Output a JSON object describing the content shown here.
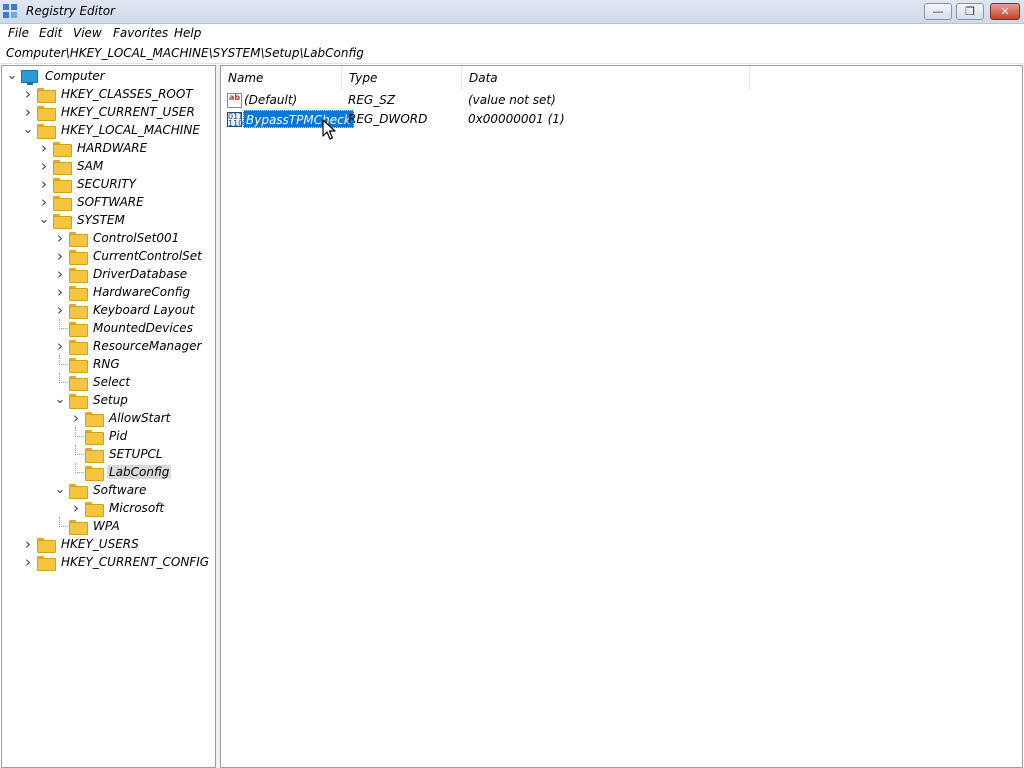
{
  "window": {
    "title": "Registry Editor",
    "min_glyph": "—",
    "restore_glyph": "❐",
    "close_glyph": "✕"
  },
  "menu": [
    "File",
    "Edit",
    "View",
    "Favorites",
    "Help"
  ],
  "address": "Computer\\HKEY_LOCAL_MACHINE\\SYSTEM\\Setup\\LabConfig",
  "tree": [
    {
      "label": "Computer",
      "level": 0,
      "chevron": "down",
      "icon": "computer-icon"
    },
    {
      "label": "HKEY_CLASSES_ROOT",
      "level": 1,
      "chevron": "right",
      "icon": "folder-icon"
    },
    {
      "label": "HKEY_CURRENT_USER",
      "level": 1,
      "chevron": "right",
      "icon": "folder-icon"
    },
    {
      "label": "HKEY_LOCAL_MACHINE",
      "level": 1,
      "chevron": "down",
      "icon": "folder-icon"
    },
    {
      "label": "HARDWARE",
      "level": 2,
      "chevron": "right",
      "icon": "folder-icon"
    },
    {
      "label": "SAM",
      "level": 2,
      "chevron": "right",
      "icon": "folder-icon"
    },
    {
      "label": "SECURITY",
      "level": 2,
      "chevron": "right",
      "icon": "folder-icon"
    },
    {
      "label": "SOFTWARE",
      "level": 2,
      "chevron": "right",
      "icon": "folder-icon"
    },
    {
      "label": "SYSTEM",
      "level": 2,
      "chevron": "down",
      "icon": "folder-icon"
    },
    {
      "label": "ControlSet001",
      "level": 3,
      "chevron": "right",
      "icon": "folder-icon"
    },
    {
      "label": "CurrentControlSet",
      "level": 3,
      "chevron": "right",
      "icon": "folder-icon"
    },
    {
      "label": "DriverDatabase",
      "level": 3,
      "chevron": "right",
      "icon": "folder-icon"
    },
    {
      "label": "HardwareConfig",
      "level": 3,
      "chevron": "right",
      "icon": "folder-icon"
    },
    {
      "label": "Keyboard Layout",
      "level": 3,
      "chevron": "right",
      "icon": "folder-icon"
    },
    {
      "label": "MountedDevices",
      "level": 3,
      "chevron": "none",
      "icon": "folder-icon"
    },
    {
      "label": "ResourceManager",
      "level": 3,
      "chevron": "right",
      "icon": "folder-icon"
    },
    {
      "label": "RNG",
      "level": 3,
      "chevron": "none",
      "icon": "folder-icon"
    },
    {
      "label": "Select",
      "level": 3,
      "chevron": "none",
      "icon": "folder-icon"
    },
    {
      "label": "Setup",
      "level": 3,
      "chevron": "down",
      "icon": "folder-icon"
    },
    {
      "label": "AllowStart",
      "level": 4,
      "chevron": "right",
      "icon": "folder-icon"
    },
    {
      "label": "Pid",
      "level": 4,
      "chevron": "none",
      "icon": "folder-icon"
    },
    {
      "label": "SETUPCL",
      "level": 4,
      "chevron": "none",
      "icon": "folder-icon"
    },
    {
      "label": "LabConfig",
      "level": 4,
      "chevron": "none",
      "icon": "folder-icon",
      "selected": true
    },
    {
      "label": "Software",
      "level": 3,
      "chevron": "down",
      "icon": "folder-icon"
    },
    {
      "label": "Microsoft",
      "level": 4,
      "chevron": "right",
      "icon": "folder-icon"
    },
    {
      "label": "WPA",
      "level": 3,
      "chevron": "none",
      "icon": "folder-icon"
    },
    {
      "label": "HKEY_USERS",
      "level": 1,
      "chevron": "right",
      "icon": "folder-icon"
    },
    {
      "label": "HKEY_CURRENT_CONFIG",
      "level": 1,
      "chevron": "right",
      "icon": "folder-icon"
    }
  ],
  "columns": {
    "name": "Name",
    "type": "Type",
    "data": "Data"
  },
  "values": [
    {
      "name": "(Default)",
      "type": "REG_SZ",
      "data": "(value not set)",
      "icon": "string-value-icon",
      "icon_glyph": "ab"
    },
    {
      "name": "BypassTPMCheck",
      "type": "REG_DWORD",
      "data": "0x00000001 (1)",
      "icon": "binary-value-icon",
      "icon_glyph": "011 110",
      "selected": true
    }
  ]
}
